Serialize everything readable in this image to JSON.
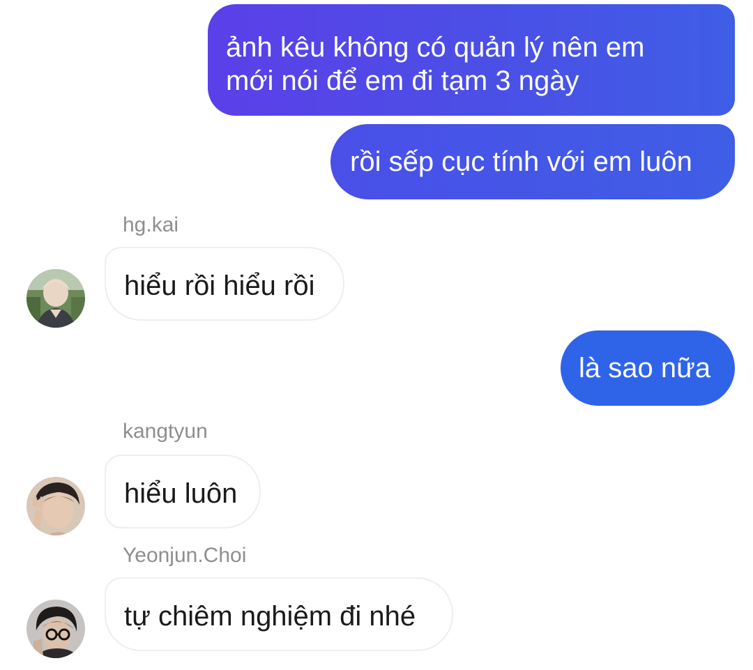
{
  "messages": {
    "m1": {
      "line1": "ảnh kêu không có quản lý nên em",
      "line2": "mới nói để em đi tạm 3 ngày"
    },
    "m2": {
      "text": "rồi sếp cục tính với em luôn"
    },
    "m3": {
      "sender": "hg.kai",
      "text": "hiểu rồi hiểu rồi"
    },
    "m4": {
      "text": "là sao nữa"
    },
    "m5": {
      "sender": "kangtyun",
      "text": "hiểu luôn"
    },
    "m6": {
      "sender": "Yeonjun.Choi",
      "text": "tự chiêm nghiệm đi nhé"
    }
  },
  "colors": {
    "outgoing_start": "#5b3fe8",
    "outgoing_end": "#3f5ee6",
    "incoming_border": "#eceef2",
    "sender_name": "#8e8e8e"
  }
}
